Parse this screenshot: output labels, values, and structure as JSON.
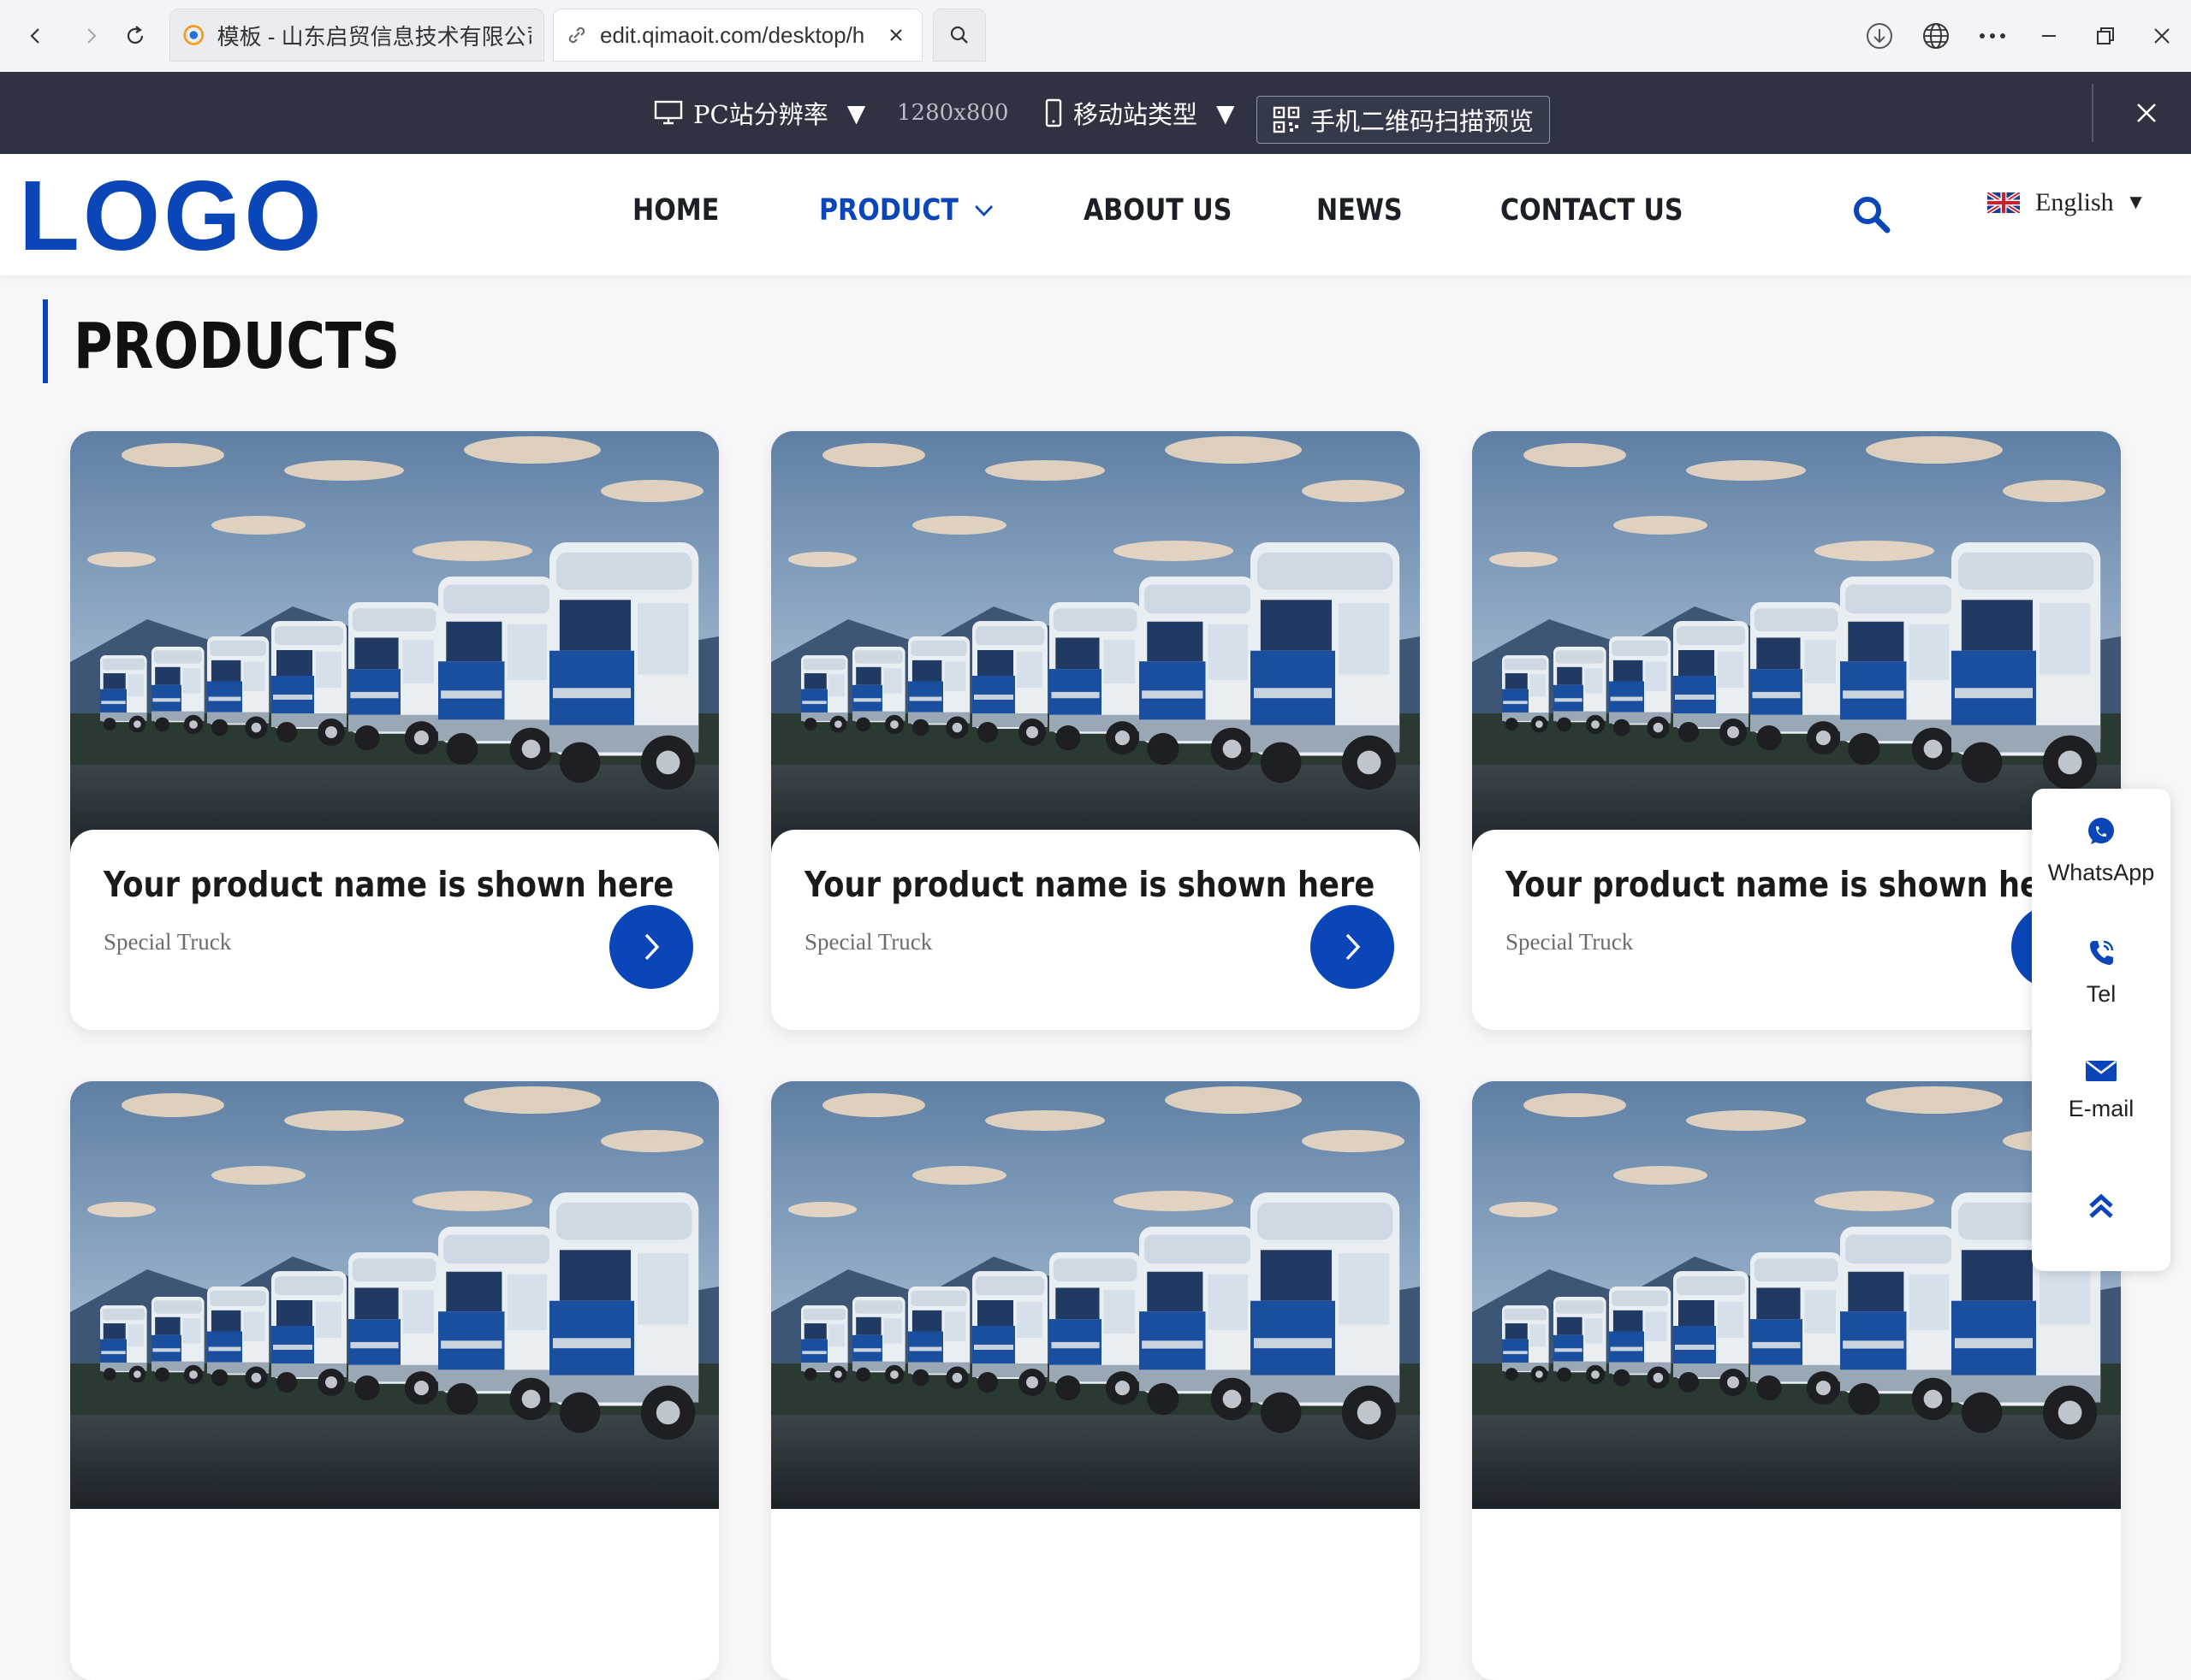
{
  "browser": {
    "tabs": [
      {
        "title": "模板 - 山东启贸信息技术有限公司"
      },
      {
        "title": "edit.qimaoit.com/desktop/h"
      }
    ]
  },
  "editor_bar": {
    "resolution_label": "PC站分辨率",
    "resolution_value": "1280x800",
    "mobile_label": "移动站类型",
    "qr_label": "手机二维码扫描预览"
  },
  "header": {
    "logo": "LOGO",
    "nav": [
      "HOME",
      "PRODUCT",
      "ABOUT US",
      "NEWS",
      "CONTACT US"
    ],
    "active_nav": "PRODUCT",
    "language": "English"
  },
  "main": {
    "title": "PRODUCTS",
    "products": [
      {
        "name": "Your product name is shown here",
        "category": "Special Truck"
      },
      {
        "name": "Your product name is shown here",
        "category": "Special Truck"
      },
      {
        "name": "Your product name is shown here",
        "category": "Special Truck"
      },
      {
        "name": "",
        "category": ""
      },
      {
        "name": "",
        "category": ""
      },
      {
        "name": "",
        "category": ""
      }
    ]
  },
  "float_panel": {
    "items": [
      {
        "label": "WhatsApp",
        "icon": "whatsapp-icon"
      },
      {
        "label": "Tel",
        "icon": "phone-icon"
      },
      {
        "label": "E-mail",
        "icon": "mail-icon"
      },
      {
        "label": "",
        "icon": "back-to-top-icon"
      }
    ]
  },
  "colors": {
    "brand": "#0b46b8",
    "toolbar_bg": "#2e3241"
  }
}
